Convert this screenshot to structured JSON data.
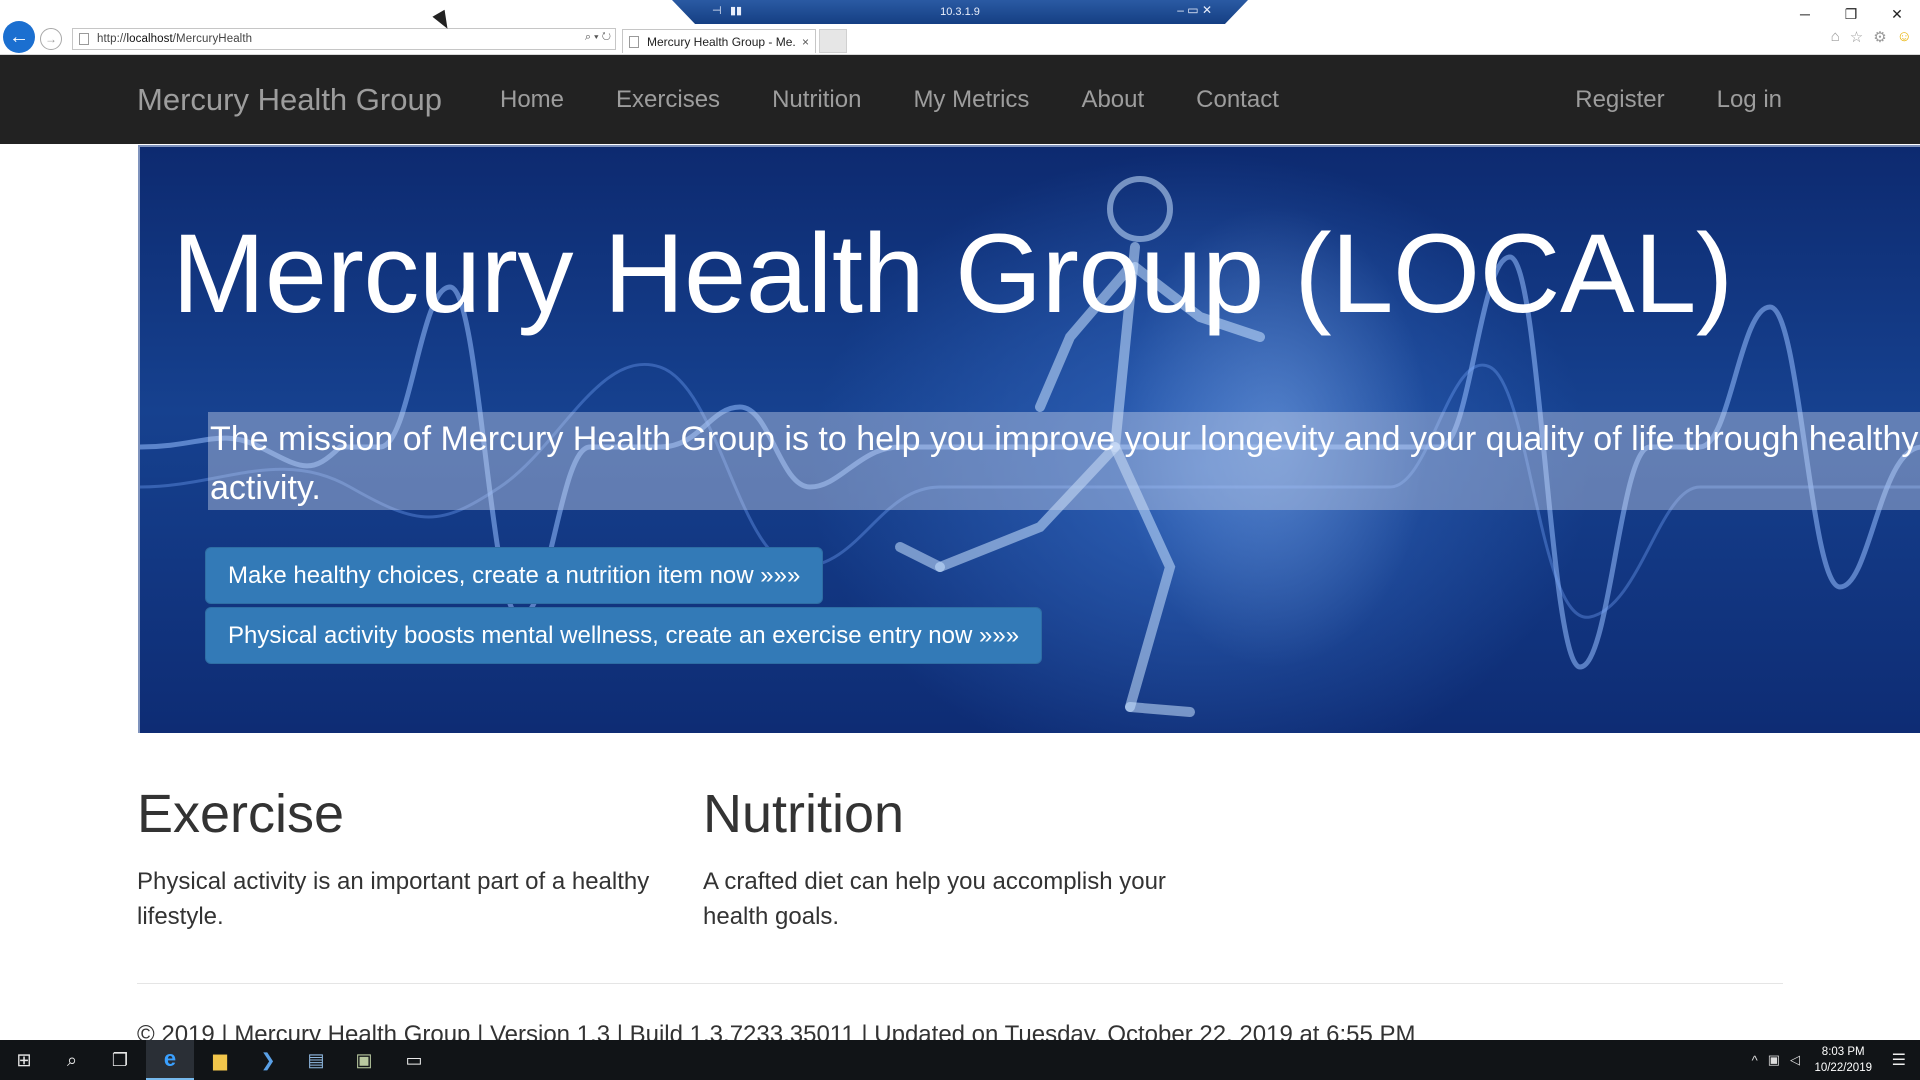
{
  "browser": {
    "url_prefix": "http://",
    "url_host": "localhost",
    "url_path": "/MercuryHealth",
    "tab_title": "Mercury Health Group - Me...",
    "tab_close": "×",
    "addr_tools": "⌕ ▾ ↻",
    "back_glyph": "←",
    "forward_glyph": "→",
    "min_glyph": "─",
    "restore_glyph": "❐",
    "close_glyph": "✕",
    "tools": {
      "home": "⌂",
      "favorites": "☆",
      "settings": "⚙",
      "feedback": "☺"
    }
  },
  "rdp": {
    "ip": "10.3.1.9",
    "pin": "⊣",
    "signal": "▮▮",
    "controls": "–  ▭  ✕"
  },
  "navbar": {
    "brand": "Mercury Health Group",
    "links": [
      "Home",
      "Exercises",
      "Nutrition",
      "My Metrics",
      "About",
      "Contact"
    ],
    "right_links": [
      "Register",
      "Log in"
    ]
  },
  "hero": {
    "title": "Mercury Health Group (LOCAL)",
    "mission_line1": "The mission of Mercury Health Group is to help you improve your longevity and your quality of life through healthy",
    "mission_line2": "activity.",
    "cta_nutrition": "Make healthy choices, create a nutrition item now »»»",
    "cta_exercise": "Physical activity boosts mental wellness, create an exercise entry now »»»"
  },
  "sections": {
    "exercise": {
      "title": "Exercise",
      "text": "Physical activity is an important part of a healthy lifestyle."
    },
    "nutrition": {
      "title": "Nutrition",
      "text": "A crafted diet can help you accomplish your health goals."
    }
  },
  "footer": {
    "text": "© 2019 | Mercury Health Group | Version 1.3 | Build 1.3.7233.35011 | Updated on Tuesday, October 22, 2019 at 6:55 PM"
  },
  "taskbar": {
    "time": "8:03 PM",
    "date": "10/22/2019",
    "icons": {
      "start": "⊞",
      "search": "⌕",
      "taskview": "❐",
      "ie": "e",
      "explorer": "▆",
      "powershell": "❯",
      "server_manager": "▤",
      "tools": "▣",
      "cmd": "▭"
    },
    "tray": {
      "chevron": "^",
      "network": "▣",
      "volume": "◁",
      "notifications": "☰"
    }
  }
}
